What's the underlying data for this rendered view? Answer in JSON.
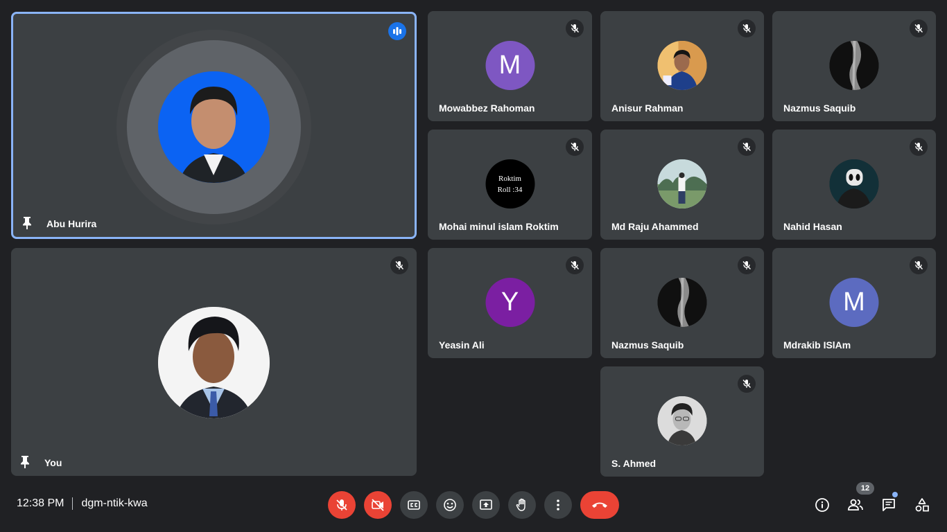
{
  "meeting": {
    "time": "12:38 PM",
    "code": "dgm-ntik-kwa"
  },
  "colors": {
    "background": "#202124",
    "tile": "#3c4043",
    "active_border": "#8ab4f8",
    "end_call": "#ea4335"
  },
  "main_tiles": [
    {
      "name": "Abu Hurira",
      "pinned": true,
      "speaking": true
    },
    {
      "name": "You",
      "pinned": true
    }
  ],
  "tiles": [
    {
      "name": "Mowabbez Rahoman",
      "avatar_letter": "M",
      "avatar_color": "#7e57c2"
    },
    {
      "name": "Anisur Rahman"
    },
    {
      "name": "Nazmus Saquib"
    },
    {
      "name": "Mohai minul islam Roktim",
      "avatar_text": [
        "Roktim",
        "Roll :34"
      ]
    },
    {
      "name": "Md Raju Ahammed"
    },
    {
      "name": "Nahid Hasan"
    },
    {
      "name": "Yeasin Ali",
      "avatar_letter": "Y",
      "avatar_color": "#7b1fa2"
    },
    {
      "name": "Nazmus Saquib"
    },
    {
      "name": "Mdrakib ISlAm",
      "avatar_letter": "M",
      "avatar_color": "#5c6bc0"
    },
    {
      "name": "S. Ahmed"
    }
  ],
  "toolbar": {
    "buttons": [
      "mic-off",
      "camera-off",
      "captions",
      "emoji",
      "present",
      "raise-hand",
      "more-options",
      "end-call"
    ],
    "people_count": "12"
  },
  "icons": {
    "pin": "pin-icon",
    "muted": "mic-off-icon",
    "speaking": "audio-level-icon",
    "info": "info-icon",
    "people": "people-icon",
    "chat": "chat-icon",
    "activities": "activities-icon"
  }
}
